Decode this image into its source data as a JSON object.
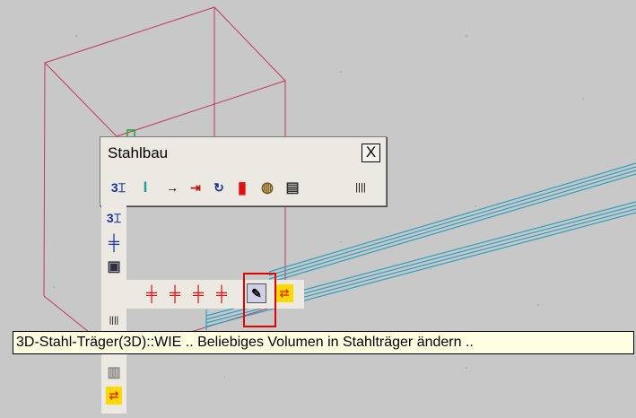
{
  "palette": {
    "title": "Stahlbau",
    "close_label": "X",
    "tools": [
      {
        "icon": "beam-3d-icon",
        "glyph": "3⌶"
      },
      {
        "icon": "i-beam-icon",
        "glyph": "I"
      },
      {
        "icon": "arrow-right-icon",
        "glyph": "→"
      },
      {
        "icon": "dimension-icon",
        "glyph": "⇥"
      },
      {
        "icon": "rotate-icon",
        "glyph": "↻"
      },
      {
        "icon": "red-block-icon",
        "glyph": "▮"
      },
      {
        "icon": "bolt-icon",
        "glyph": "◍"
      },
      {
        "icon": "calendar-icon",
        "glyph": "▤"
      },
      {
        "icon": "grip-handle-icon",
        "glyph": "||||"
      }
    ]
  },
  "flyout_vertical": [
    {
      "icon": "beam-3d-icon",
      "glyph": "3⌶"
    },
    {
      "icon": "cross-beam-icon",
      "glyph": "╪"
    },
    {
      "icon": "box-section-icon",
      "glyph": "▣"
    },
    {
      "icon": "profile-active-icon",
      "glyph": "╪"
    },
    {
      "icon": "columns-icon",
      "glyph": "||||"
    },
    {
      "icon": "disabled-icon",
      "glyph": "▬"
    },
    {
      "icon": "frame-icon",
      "glyph": "▥"
    },
    {
      "icon": "transfer-icon",
      "glyph": "⇄"
    }
  ],
  "flyout_horizontal": [
    {
      "icon": "profile-icon-1",
      "glyph": "╪"
    },
    {
      "icon": "profile-icon-2",
      "glyph": "╪"
    },
    {
      "icon": "profile-icon-3",
      "glyph": "╪"
    },
    {
      "icon": "profile-icon-4",
      "glyph": "╪"
    },
    {
      "icon": "edit-volume-icon",
      "glyph": "✎"
    },
    {
      "icon": "transfer-icon",
      "glyph": "⇄"
    }
  ],
  "tooltip": {
    "text": "3D-Stahl-Träger(3D)::WIE .. Beliebiges Volumen in Stahlträger ändern .."
  },
  "colors": {
    "background": "#c8c8c8",
    "wireframe_box": "#c0395a",
    "beam_lines": "#2f9fbf",
    "highlight": "#e00000",
    "tooltip_bg": "#fffee1"
  }
}
